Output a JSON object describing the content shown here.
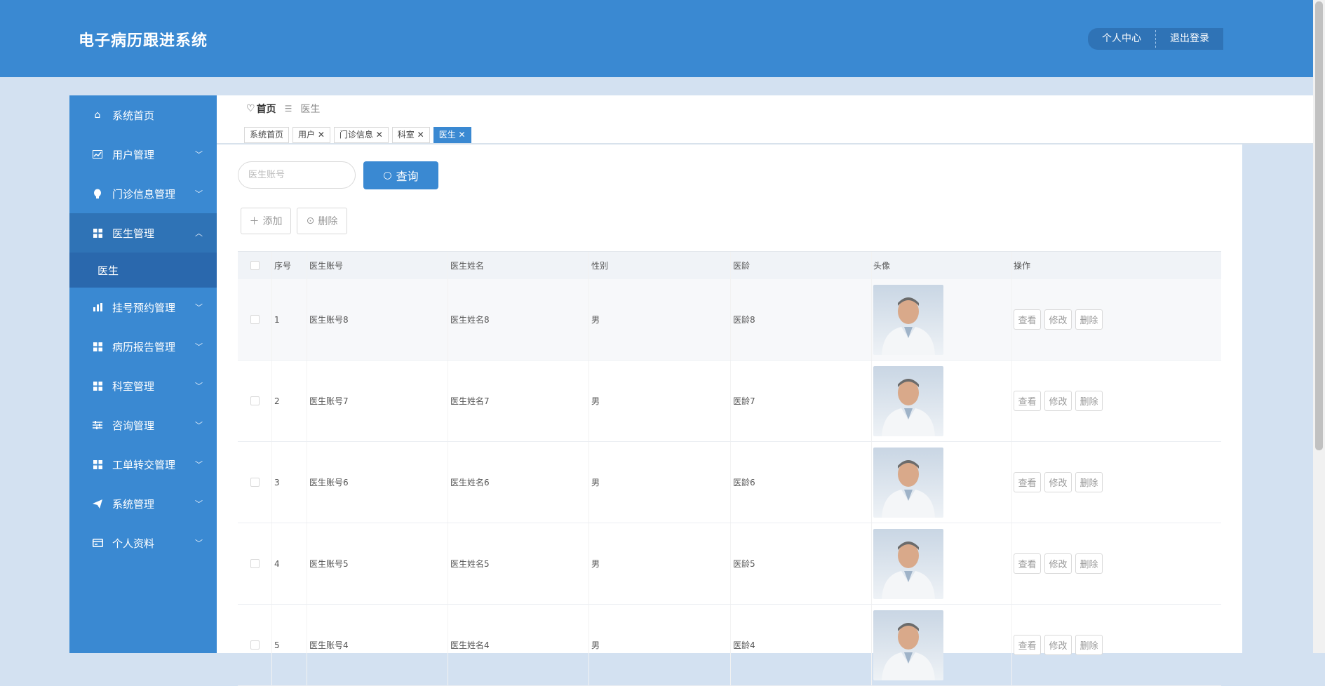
{
  "app": {
    "title": "电子病历跟进系统",
    "header_buttons": [
      "个人中心",
      "退出登录"
    ]
  },
  "sidebar": {
    "items": [
      {
        "label": "系统首页",
        "icon": "home-icon"
      },
      {
        "label": "用户管理",
        "icon": "chart-icon"
      },
      {
        "label": "门诊信息管理",
        "icon": "bulb-icon"
      },
      {
        "label": "医生管理",
        "icon": "grid-icon",
        "open": true,
        "children": [
          "医生"
        ]
      },
      {
        "label": "挂号预约管理",
        "icon": "bar-chart-icon"
      },
      {
        "label": "病历报告管理",
        "icon": "grid-icon"
      },
      {
        "label": "科室管理",
        "icon": "grid-icon"
      },
      {
        "label": "咨询管理",
        "icon": "sliders-icon"
      },
      {
        "label": "工单转交管理",
        "icon": "grid-icon"
      },
      {
        "label": "系统管理",
        "icon": "send-icon"
      },
      {
        "label": "个人资料",
        "icon": "card-icon"
      }
    ]
  },
  "breadcrumb": {
    "home": "首页",
    "current": "医生"
  },
  "tabs": [
    {
      "label": "系统首页",
      "closable": false
    },
    {
      "label": "用户",
      "closable": true
    },
    {
      "label": "门诊信息",
      "closable": true
    },
    {
      "label": "科室",
      "closable": true
    },
    {
      "label": "医生",
      "closable": true,
      "active": true
    }
  ],
  "search": {
    "placeholder": "医生账号",
    "query_label": "查询"
  },
  "actions": {
    "add_label": "添加",
    "delete_label": "删除"
  },
  "table": {
    "columns": [
      "序号",
      "医生账号",
      "医生姓名",
      "性别",
      "医龄",
      "头像",
      "操作"
    ],
    "row_actions": [
      "查看",
      "修改",
      "删除"
    ],
    "rows": [
      {
        "idx": "1",
        "account": "医生账号8",
        "name": "医生姓名8",
        "gender": "男",
        "age": "医龄8"
      },
      {
        "idx": "2",
        "account": "医生账号7",
        "name": "医生姓名7",
        "gender": "男",
        "age": "医龄7"
      },
      {
        "idx": "3",
        "account": "医生账号6",
        "name": "医生姓名6",
        "gender": "男",
        "age": "医龄6"
      },
      {
        "idx": "4",
        "account": "医生账号5",
        "name": "医生姓名5",
        "gender": "男",
        "age": "医龄5"
      },
      {
        "idx": "5",
        "account": "医生账号4",
        "name": "医生姓名4",
        "gender": "男",
        "age": "医龄4"
      }
    ]
  },
  "colors": {
    "primary": "#3a89d2",
    "sidebar_active": "#2f73b6",
    "background": "#d3e1f1"
  }
}
